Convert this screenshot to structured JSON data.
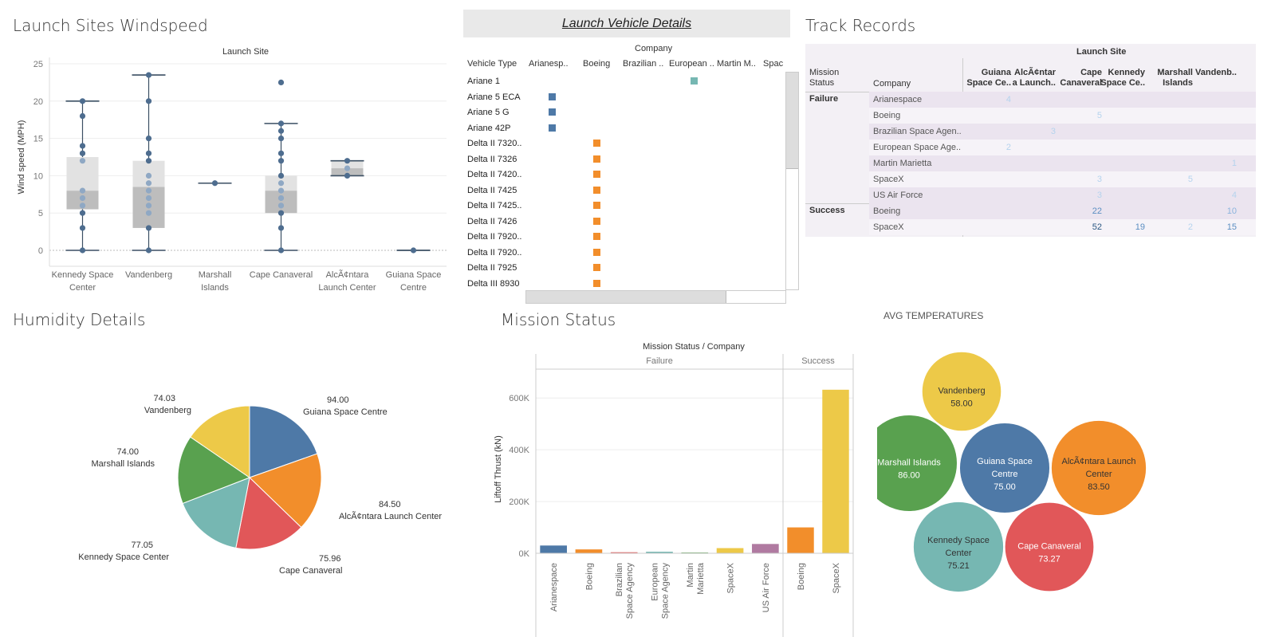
{
  "windspeed": {
    "title": "Launch Sites Windspeed",
    "chart_data": {
      "type": "box",
      "top_label": "Launch Site",
      "ylabel": "Wind speed (MPH)",
      "ylim": [
        0,
        25
      ],
      "yticks": [
        0,
        5,
        10,
        15,
        20,
        25
      ],
      "categories": [
        "Kennedy Space Center",
        "Vandenberg",
        "Marshall Islands",
        "Cape Canaveral",
        "AlcÃ¢ntara Launch Center",
        "Guiana Space Centre"
      ],
      "category_lines": [
        [
          "Kennedy Space",
          "Center"
        ],
        [
          "Vandenberg"
        ],
        [
          "Marshall",
          "Islands"
        ],
        [
          "Cape Canaveral"
        ],
        [
          "AlcÃ¢ntara",
          "Launch Center"
        ],
        [
          "Guiana Space",
          "Centre"
        ]
      ],
      "boxes": [
        {
          "min": 0,
          "q1": 5.5,
          "median": 8,
          "q3": 12.5,
          "max": 20,
          "points": [
            0,
            3,
            5,
            6,
            7,
            8,
            12,
            13,
            14,
            18,
            20
          ]
        },
        {
          "min": 0,
          "q1": 3,
          "median": 8.5,
          "q3": 12,
          "max": 23.5,
          "points": [
            0,
            3,
            5,
            6,
            7,
            8,
            9,
            10,
            12,
            13,
            15,
            20,
            23.5
          ]
        },
        {
          "min": 9,
          "q1": 9,
          "median": 9,
          "q3": 9,
          "max": 9,
          "points": [
            9
          ]
        },
        {
          "min": 0,
          "q1": 5,
          "median": 8,
          "q3": 10,
          "max": 17,
          "points": [
            0,
            3,
            5,
            6,
            7,
            8,
            9,
            10,
            12,
            13,
            15,
            16,
            17,
            22.5
          ]
        },
        {
          "min": 10,
          "q1": 10,
          "median": 11,
          "q3": 12,
          "max": 12,
          "points": [
            10,
            11,
            12
          ]
        },
        {
          "min": 0,
          "q1": 0,
          "median": 0,
          "q3": 0,
          "max": 0,
          "points": [
            0
          ]
        }
      ]
    }
  },
  "vehicle_details": {
    "title": "Launch Vehicle Details",
    "company_header": "Company",
    "row_header": "Vehicle Type",
    "columns": [
      "Arianesp..",
      "Boeing",
      "Brazilian ..",
      "European ..",
      "Martin M..",
      "Spac"
    ],
    "rows": [
      {
        "name": "Ariane 1",
        "col": 3,
        "color": "#76b7b2"
      },
      {
        "name": "Ariane 5 ECA",
        "col": 0,
        "color": "#4e79a7"
      },
      {
        "name": "Ariane 5 G",
        "col": 0,
        "color": "#4e79a7"
      },
      {
        "name": "Ariane 42P",
        "col": 0,
        "color": "#4e79a7"
      },
      {
        "name": "Delta II 7320..",
        "col": 1,
        "color": "#f28e2b"
      },
      {
        "name": "Delta II 7326",
        "col": 1,
        "color": "#f28e2b"
      },
      {
        "name": "Delta II 7420..",
        "col": 1,
        "color": "#f28e2b"
      },
      {
        "name": "Delta II 7425",
        "col": 1,
        "color": "#f28e2b"
      },
      {
        "name": "Delta II 7425..",
        "col": 1,
        "color": "#f28e2b"
      },
      {
        "name": "Delta II 7426",
        "col": 1,
        "color": "#f28e2b"
      },
      {
        "name": "Delta II 7920..",
        "col": 1,
        "color": "#f28e2b"
      },
      {
        "name": "Delta II 7920..",
        "col": 1,
        "color": "#f28e2b"
      },
      {
        "name": "Delta II 7925",
        "col": 1,
        "color": "#f28e2b"
      },
      {
        "name": "Delta III 8930",
        "col": 1,
        "color": "#f28e2b"
      }
    ]
  },
  "track_records": {
    "title": "Track Records",
    "launch_site_header": "Launch Site",
    "mission_status_header": "Mission Status",
    "company_header": "Company",
    "site_columns": [
      [
        "Guiana",
        "Space Ce.."
      ],
      [
        "AlcÃ¢ntar",
        "a Launch.."
      ],
      [
        "Cape",
        "Canaveral"
      ],
      [
        "Kennedy",
        "Space Ce.."
      ],
      [
        "Marshall",
        "Islands"
      ],
      [
        "Vandenb.."
      ]
    ],
    "groups": [
      {
        "status": "Failure",
        "rows": [
          {
            "company": "Arianespace",
            "values": [
              "4",
              "",
              "",
              "",
              "",
              ""
            ]
          },
          {
            "company": "Boeing",
            "values": [
              "",
              "",
              "5",
              "",
              "",
              ""
            ]
          },
          {
            "company": "Brazilian Space Agen..",
            "values": [
              "",
              "3",
              "",
              "",
              "",
              ""
            ]
          },
          {
            "company": "European Space Age..",
            "values": [
              "2",
              "",
              "",
              "",
              "",
              ""
            ]
          },
          {
            "company": "Martin Marietta",
            "values": [
              "",
              "",
              "",
              "",
              "",
              "1"
            ]
          },
          {
            "company": "SpaceX",
            "values": [
              "",
              "",
              "3",
              "",
              "5",
              ""
            ]
          },
          {
            "company": "US Air Force",
            "values": [
              "",
              "",
              "3",
              "",
              "",
              "4"
            ]
          }
        ]
      },
      {
        "status": "Success",
        "rows": [
          {
            "company": "Boeing",
            "values": [
              "",
              "",
              "22",
              "",
              "",
              "10"
            ]
          },
          {
            "company": "SpaceX",
            "values": [
              "",
              "",
              "52",
              "19",
              "2",
              "15"
            ]
          }
        ]
      }
    ]
  },
  "humidity": {
    "title": "Humidity Details",
    "chart_data": {
      "type": "pie",
      "slices": [
        {
          "label": "Guiana Space Centre",
          "value": 94.0,
          "color": "#4e79a7"
        },
        {
          "label": "AlcÃ¢ntara Launch Center",
          "value": 84.5,
          "color": "#f28e2b"
        },
        {
          "label": "Cape Canaveral",
          "value": 75.96,
          "color": "#e15759"
        },
        {
          "label": "Kennedy Space Center",
          "value": 77.05,
          "color": "#76b7b2"
        },
        {
          "label": "Marshall Islands",
          "value": 74.0,
          "color": "#59a14f"
        },
        {
          "label": "Vandenberg",
          "value": 74.03,
          "color": "#edc948"
        }
      ],
      "value_texts": [
        "94.00",
        "84.50",
        "75.96",
        "77.05",
        "74.00",
        "74.03"
      ]
    }
  },
  "mission_status": {
    "title": "Mission Status",
    "chart_data": {
      "type": "bar",
      "top_label": "Mission Status  /  Company",
      "ylabel": "Liftoff Thrust (kN)",
      "ylim": [
        0,
        650000
      ],
      "yticks": [
        0,
        200000,
        400000,
        600000
      ],
      "ytick_labels": [
        "0K",
        "200K",
        "400K",
        "600K"
      ],
      "panels": [
        {
          "name": "Failure",
          "bars": [
            {
              "category": "Arianespace",
              "lines": [
                "Arianespace"
              ],
              "value": 30000,
              "color": "#4e79a7"
            },
            {
              "category": "Boeing",
              "lines": [
                "Boeing"
              ],
              "value": 15000,
              "color": "#f28e2b"
            },
            {
              "category": "Brazilian Space Agency",
              "lines": [
                "Brazilian",
                "Space Agency"
              ],
              "value": 4000,
              "color": "#e15759"
            },
            {
              "category": "European Space Agency",
              "lines": [
                "European",
                "Space Agency"
              ],
              "value": 6000,
              "color": "#76b7b2"
            },
            {
              "category": "Martin Marietta",
              "lines": [
                "Martin",
                "Marietta"
              ],
              "value": 3000,
              "color": "#59a14f"
            },
            {
              "category": "SpaceX",
              "lines": [
                "SpaceX"
              ],
              "value": 20000,
              "color": "#edc948"
            },
            {
              "category": "US Air Force",
              "lines": [
                "US Air Force"
              ],
              "value": 36000,
              "color": "#b07aa1"
            }
          ]
        },
        {
          "name": "Success",
          "bars": [
            {
              "category": "Boeing",
              "lines": [
                "Boeing"
              ],
              "value": 100000,
              "color": "#f28e2b"
            },
            {
              "category": "SpaceX",
              "lines": [
                "SpaceX"
              ],
              "value": 632000,
              "color": "#edc948"
            }
          ]
        }
      ]
    }
  },
  "avg_temperatures": {
    "title": "AVG TEMPERATURES",
    "chart_data": {
      "type": "bubble",
      "bubbles": [
        {
          "label": "Vandenberg",
          "lines": [
            "Vandenberg"
          ],
          "value": 58.0,
          "value_text": "58.00",
          "color": "#edc948",
          "text_color": "#333333"
        },
        {
          "label": "Marshall Islands",
          "lines": [
            "Marshall Islands"
          ],
          "value": 86.0,
          "value_text": "86.00",
          "color": "#59a14f",
          "text_color": "#ffffff"
        },
        {
          "label": "Guiana Space Centre",
          "lines": [
            "Guiana Space",
            "Centre"
          ],
          "value": 75.0,
          "value_text": "75.00",
          "color": "#4e79a7",
          "text_color": "#ffffff"
        },
        {
          "label": "AlcÃ¢ntara Launch Center",
          "lines": [
            "AlcÃ¢ntara Launch",
            "Center"
          ],
          "value": 83.5,
          "value_text": "83.50",
          "color": "#f28e2b",
          "text_color": "#333333"
        },
        {
          "label": "Kennedy Space Center",
          "lines": [
            "Kennedy Space",
            "Center"
          ],
          "value": 75.21,
          "value_text": "75.21",
          "color": "#76b7b2",
          "text_color": "#333333"
        },
        {
          "label": "Cape Canaveral",
          "lines": [
            "Cape Canaveral"
          ],
          "value": 73.27,
          "value_text": "73.27",
          "color": "#e15759",
          "text_color": "#ffffff"
        }
      ]
    }
  }
}
